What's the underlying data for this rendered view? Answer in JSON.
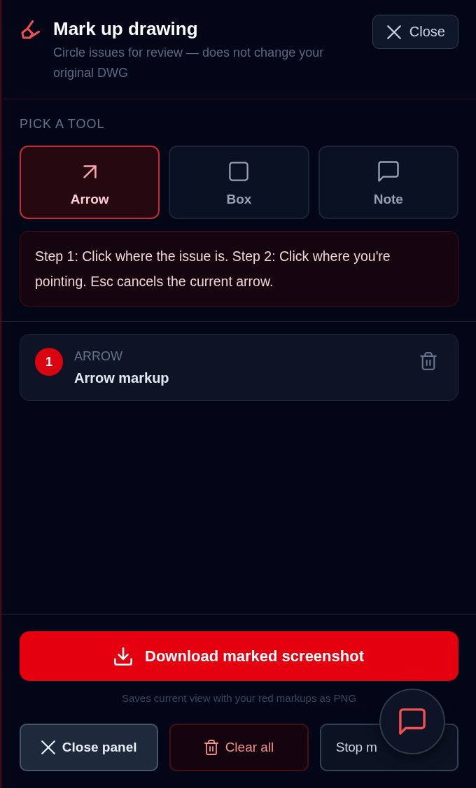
{
  "header": {
    "title": "Mark up drawing",
    "subtitle": "Circle issues for review — does not change your original DWG",
    "close_button": "Close"
  },
  "tool_section": {
    "heading": "PICK A TOOL",
    "tools": [
      {
        "kind": "arrow",
        "label": "Arrow",
        "selected": true
      },
      {
        "kind": "box",
        "label": "Box",
        "selected": false
      },
      {
        "kind": "note",
        "label": "Note",
        "selected": false
      }
    ],
    "hint": "Step 1: Click where the issue is. Step 2: Click where you're pointing. Esc cancels the current arrow."
  },
  "markups": [
    {
      "number": "1",
      "type_label": "ARROW",
      "title": "Arrow markup"
    }
  ],
  "footer": {
    "download_button": "Download marked screenshot",
    "caption": "Saves current view with your red markups as PNG",
    "buttons": [
      {
        "kind": "close",
        "label": "Close panel"
      },
      {
        "kind": "clear",
        "label": "Clear all"
      },
      {
        "kind": "stop",
        "label": "Stop m"
      }
    ]
  }
}
